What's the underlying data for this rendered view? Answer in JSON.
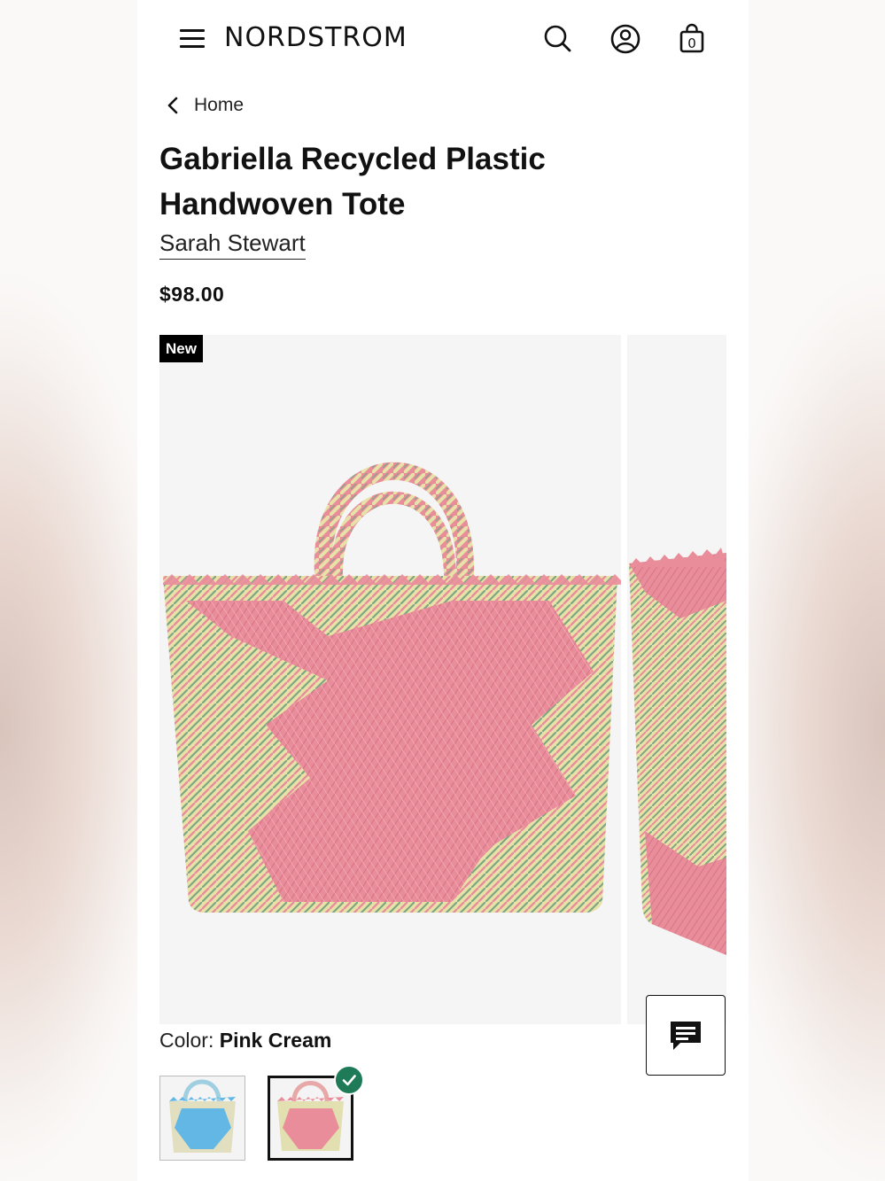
{
  "header": {
    "brand": "NORDSTROM",
    "cart_count": "0"
  },
  "nav": {
    "back_label": "Home"
  },
  "product": {
    "title": "Gabriella Recycled Plastic Handwoven Tote",
    "brand": "Sarah Stewart",
    "price": "$98.00",
    "badge": "New",
    "color_label": "Color:",
    "color_value": "Pink Cream",
    "swatches": [
      {
        "color": "Blue",
        "selected": false
      },
      {
        "color": "Pink Cream",
        "selected": true
      }
    ]
  },
  "colors": {
    "tote_pink": "#e98d9b",
    "tote_cream": "#e7e2a8",
    "tote_green": "#7fa582",
    "blue": "#62b7e4",
    "check_green": "#1e7a57"
  }
}
